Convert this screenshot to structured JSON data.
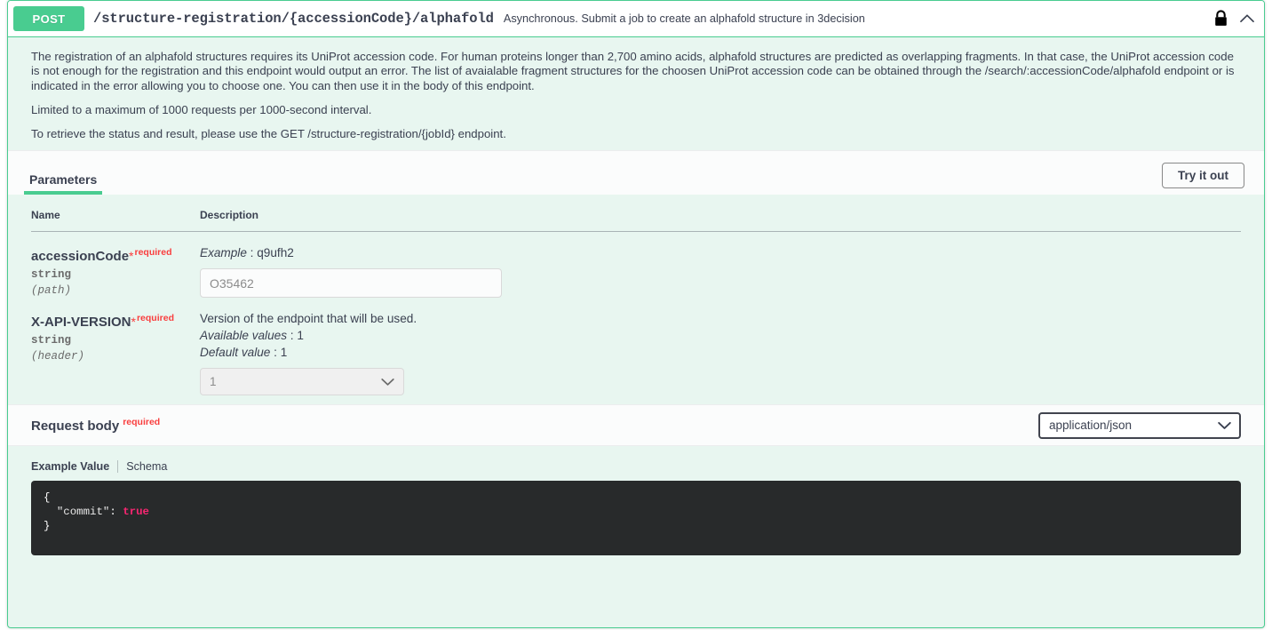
{
  "operation": {
    "method": "POST",
    "path": "/structure-registration/{accessionCode}/alphafold",
    "summary": "Asynchronous. Submit a job to create an alphafold structure in 3decision",
    "lock_icon": "lock-icon",
    "collapse_icon": "chevron-up-icon",
    "accent_color": "#49cc90",
    "background_color": "#e8f6f0",
    "description_paragraphs": [
      "The registration of an alphafold structures requires its UniProt accession code. For human proteins longer than 2,700 amino acids, alphafold structures are predicted as overlapping fragments. In that case, the UniProt accession code is not enough for the registration and this endpoint would output an error. The list of avaialable fragment structures for the choosen UniProt accession code can be obtained through the /search/:accessionCode/alphafold endpoint or is indicated in the error allowing you to choose one. You can then use it in the body of this endpoint.",
      "Limited to a maximum of 1000 requests per 1000-second interval.",
      "To retrieve the status and result, please use the GET /structure-registration/{jobId} endpoint."
    ]
  },
  "parameters_section": {
    "tab_label": "Parameters",
    "try_it_out_label": "Try it out",
    "columns": {
      "name": "Name",
      "description": "Description"
    },
    "rows": [
      {
        "name": "accessionCode",
        "required_star": "*",
        "required_label": "required",
        "type": "string",
        "location": "(path)",
        "description_label": "Example",
        "description_value": "q9ufh2",
        "input_kind": "text",
        "input_placeholder": "O35462",
        "input_value": ""
      },
      {
        "name": "X-API-VERSION",
        "required_star": "*",
        "required_label": "required",
        "type": "string",
        "location": "(header)",
        "description_line": "Version of the endpoint that will be used.",
        "available_values_label": "Available values",
        "available_values": "1",
        "default_value_label": "Default value",
        "default_value": "1",
        "input_kind": "select",
        "select_selected": "1",
        "select_options": [
          "1"
        ]
      }
    ]
  },
  "request_body": {
    "title": "Request body",
    "required_label": "required",
    "content_type_selected": "application/json",
    "content_type_options": [
      "application/json"
    ],
    "tabs": [
      {
        "label": "Example Value",
        "active": true
      },
      {
        "label": "Schema",
        "active": false
      }
    ],
    "example_code": {
      "line_open": "{",
      "key": "\"commit\"",
      "colon": ": ",
      "value": "true",
      "line_close": "}"
    }
  }
}
